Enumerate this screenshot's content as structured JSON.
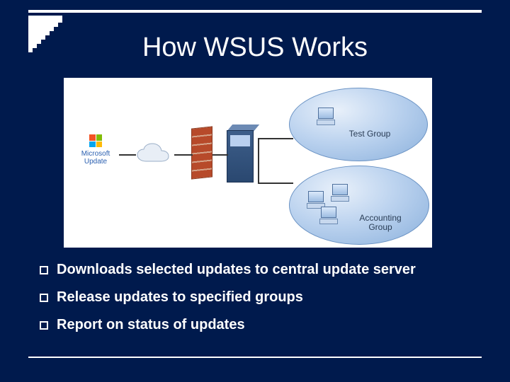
{
  "title": "How WSUS Works",
  "diagram": {
    "source_label": "Microsoft Update",
    "groups": {
      "test": "Test Group",
      "accounting": "Accounting Group"
    },
    "icons": {
      "ms_update": "microsoft-update-icon",
      "cloud": "internet-cloud-icon",
      "firewall": "firewall-icon",
      "server": "wsus-server-icon",
      "pc": "client-computer-icon"
    }
  },
  "bullets": [
    "Downloads selected updates to central update server",
    "Release updates to specified groups",
    "Report on status of updates"
  ],
  "colors": {
    "background": "#001a4d",
    "text": "#ffffff",
    "group_fill": "#bcd3ef"
  }
}
